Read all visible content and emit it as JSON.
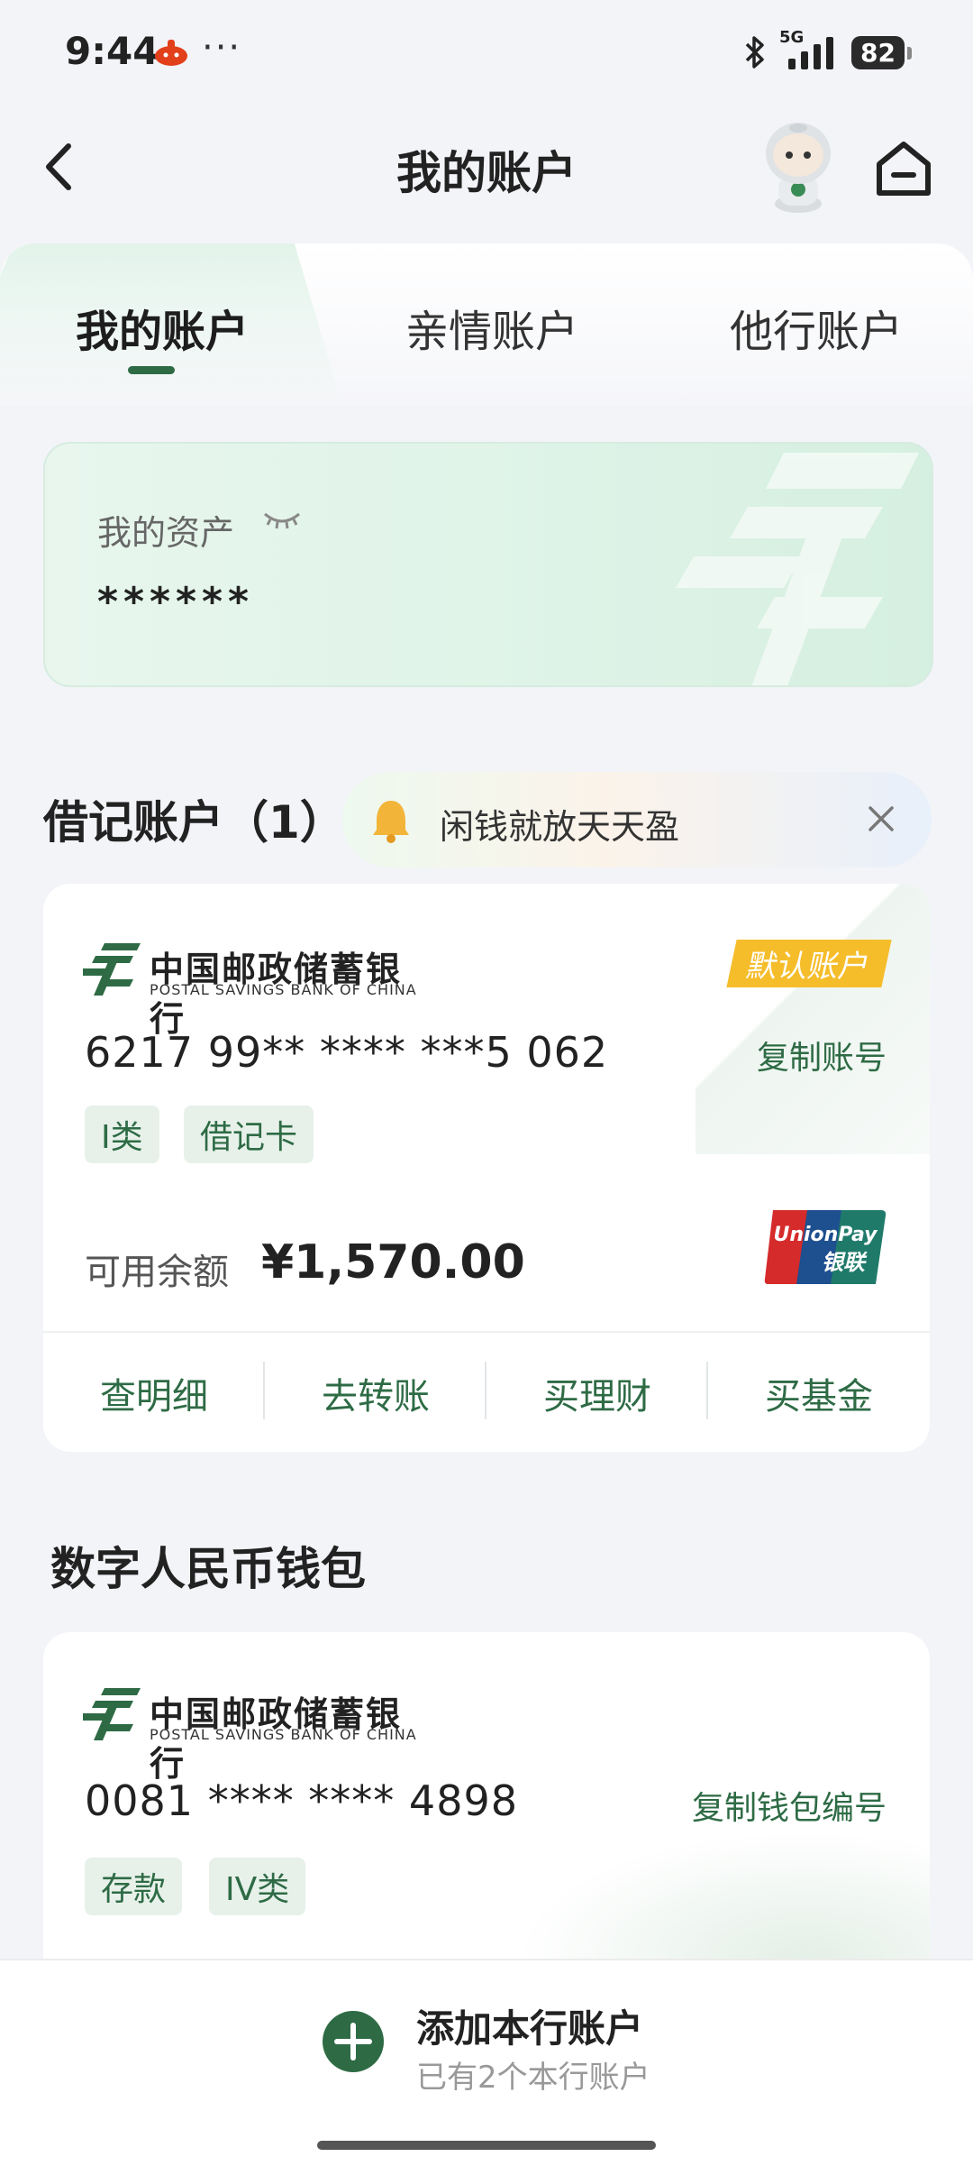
{
  "status_bar": {
    "time": "9:44",
    "network": "5G",
    "battery": "82"
  },
  "header": {
    "title": "我的账户"
  },
  "tabs": [
    {
      "label": "我的账户",
      "active": true
    },
    {
      "label": "亲情账户",
      "active": false
    },
    {
      "label": "他行账户",
      "active": false
    }
  ],
  "assets": {
    "label": "我的资产",
    "value": "******"
  },
  "debit": {
    "title": "借记账户（1）",
    "promo_text": "闲钱就放天天盈",
    "bank_name_cn": "中国邮政储蓄银行",
    "bank_name_en": "POSTAL SAVINGS BANK OF CHINA",
    "default_badge": "默认账户",
    "card_number": "6217 99** **** ***5 062",
    "copy_label": "复制账号",
    "tags": [
      "I类",
      "借记卡"
    ],
    "balance_label": "可用余额",
    "balance_value": "¥1,570.00",
    "unionpay_text_en": "UnionPay",
    "unionpay_text_cn": "银联",
    "actions": [
      "查明细",
      "去转账",
      "买理财",
      "买基金"
    ]
  },
  "ecny": {
    "title": "数字人民币钱包",
    "bank_name_cn": "中国邮政储蓄银行",
    "bank_name_en": "POSTAL SAVINGS BANK OF CHINA",
    "wallet_number": "0081 **** **** 4898",
    "copy_label": "复制钱包编号",
    "tags": [
      "存款",
      "IV类"
    ]
  },
  "bottom": {
    "add_title": "添加本行账户",
    "add_sub": "已有2个本行账户"
  },
  "colors": {
    "brand_green": "#2e6b45",
    "badge_yellow": "#f6bd2b"
  }
}
